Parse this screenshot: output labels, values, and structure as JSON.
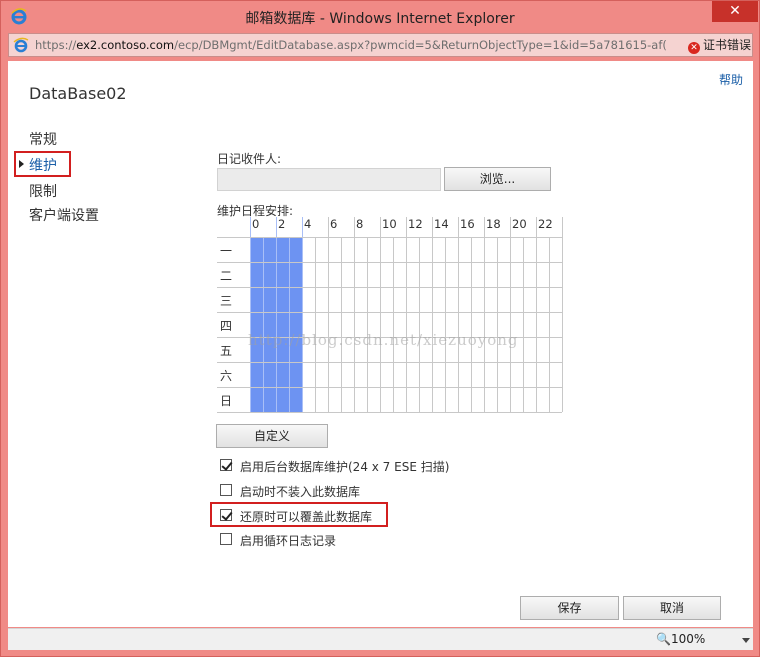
{
  "window": {
    "title": "邮箱数据库 - Windows Internet Explorer",
    "close_glyph": "✕"
  },
  "address_bar": {
    "url_prefix": "https://",
    "url_host": "ex2.contoso.com",
    "url_path": "/ecp/DBMgmt/EditDatabase.aspx?pwmcid=5&ReturnObjectType=1&id=5a781615-af(",
    "cert_error": "证书错误"
  },
  "page": {
    "help_link": "帮助",
    "database_name": "DataBase02"
  },
  "nav": {
    "items": [
      {
        "label": "常规",
        "selected": false
      },
      {
        "label": "维护",
        "selected": true
      },
      {
        "label": "限制",
        "selected": false
      },
      {
        "label": "客户端设置",
        "selected": false
      }
    ]
  },
  "form": {
    "journal_recipient_label": "日记收件人:",
    "browse_button": "浏览...",
    "schedule_label": "维护日程安排:",
    "hours": [
      "0",
      "2",
      "4",
      "6",
      "8",
      "10",
      "12",
      "14",
      "16",
      "18",
      "20",
      "22"
    ],
    "days": [
      "一",
      "二",
      "三",
      "四",
      "五",
      "六",
      "日"
    ],
    "scheduled_hours": {
      "start": 0,
      "end": 4
    },
    "customize_button": "自定义",
    "options": [
      {
        "label": "启用后台数据库维护(24 x 7 ESE 扫描)",
        "checked": true
      },
      {
        "label": "启动时不装入此数据库",
        "checked": false
      },
      {
        "label": "还原时可以覆盖此数据库",
        "checked": true
      },
      {
        "label": "启用循环日志记录",
        "checked": false
      }
    ]
  },
  "footer": {
    "save_button": "保存",
    "cancel_button": "取消"
  },
  "statusbar": {
    "zoom": "100%"
  },
  "watermark": "http://blog.csdn.net/xiezuoyong",
  "colors": {
    "titlebar": "#f08a86",
    "close": "#c7312a",
    "link": "#1b5fa8",
    "schedule_fill": "#6d93f2",
    "highlight_box": "#d21f1f"
  }
}
